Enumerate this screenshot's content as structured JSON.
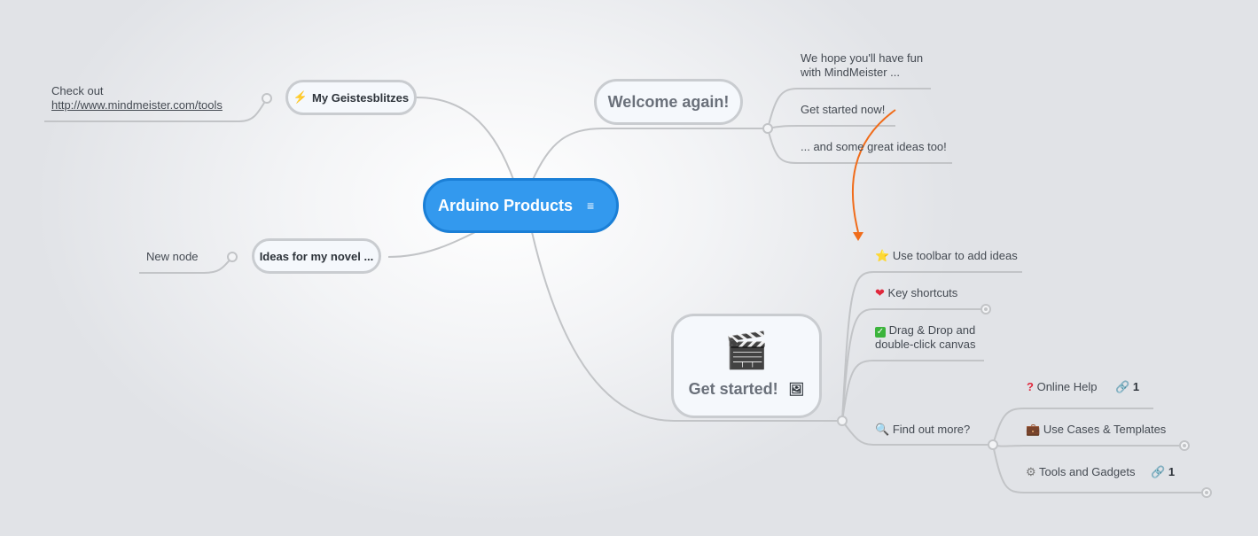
{
  "central": {
    "title": "Arduino Products",
    "icon": "note-icon"
  },
  "branches": {
    "welcome": {
      "title": "Welcome again!",
      "children": [
        "We hope you'll have fun",
        "with MindMeister ...",
        "Get started now!",
        "... and some great ideas too!"
      ]
    },
    "geistesblitzes": {
      "icon": "lightning-icon",
      "title": "My Geistesblitzes",
      "child_line1": "Check out",
      "child_link": "http://www.mindmeister.com/tools"
    },
    "ideas": {
      "title": "Ideas for my novel ...",
      "child": "New node"
    },
    "getstarted": {
      "title": "Get started!",
      "image": "clapperboard-icon",
      "image_icon": "image-icon",
      "children": {
        "toolbar": {
          "icon": "star-icon",
          "label": "Use toolbar to add ideas"
        },
        "shortcuts": {
          "icon": "heart-icon",
          "label": "Key shortcuts"
        },
        "dragdrop": {
          "icon": "check-icon",
          "label1": "Drag & Drop and",
          "label2": "double-click canvas"
        },
        "findout": {
          "icon": "magnifier-icon",
          "label": "Find out more?",
          "children": {
            "help": {
              "icon": "question-icon",
              "label": "Online Help",
              "link_count": "1"
            },
            "cases": {
              "icon": "briefcase-icon",
              "label": "Use Cases & Templates"
            },
            "tools": {
              "icon": "gear-icon",
              "label": "Tools and Gadgets",
              "link_count": "1"
            }
          }
        }
      }
    }
  },
  "colors": {
    "central_fill": "#3399ee",
    "connector": "#c2c4c7",
    "arrow": "#f06c1a"
  }
}
